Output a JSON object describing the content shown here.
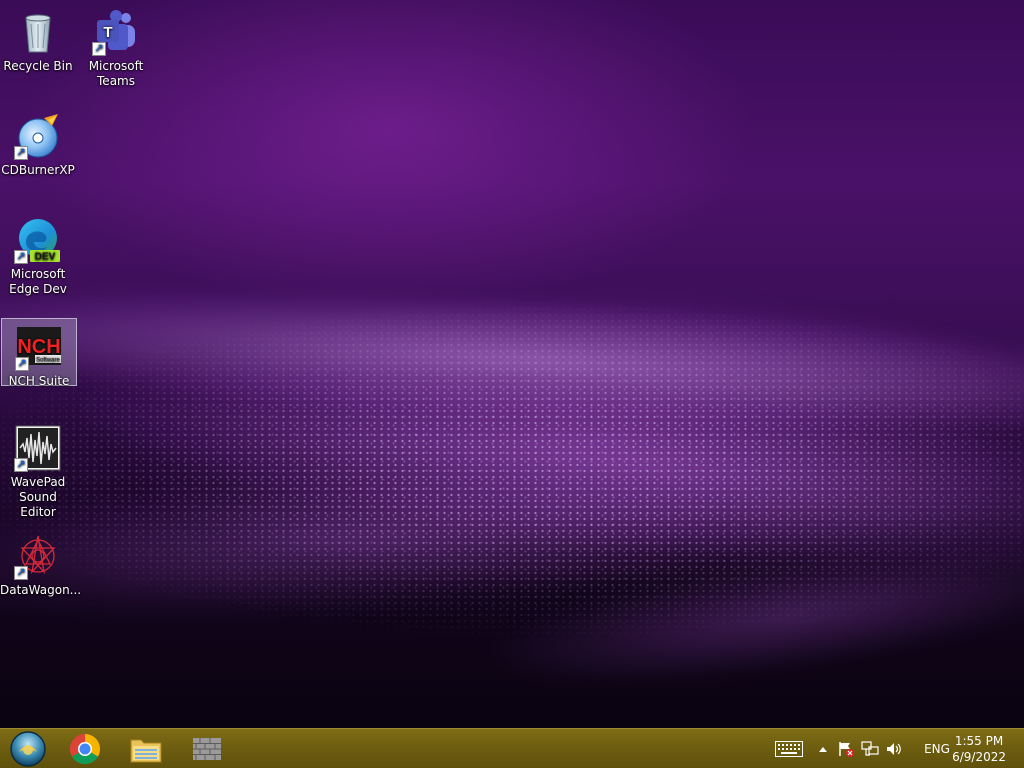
{
  "desktop": {
    "icons": [
      {
        "label": "Recycle Bin"
      },
      {
        "label": "Microsoft Teams"
      },
      {
        "label": "CDBurnerXP"
      },
      {
        "label": "Microsoft Edge Dev",
        "badge": "DEV"
      },
      {
        "label": "NCH Suite",
        "logo_text": "NCH",
        "logo_sub": "Software"
      },
      {
        "label": "WavePad Sound Editor"
      },
      {
        "label": "DataWagon..."
      }
    ]
  },
  "taskbar": {
    "pinned": [
      "start-orb",
      "chrome",
      "file-explorer",
      "wall-app"
    ],
    "tray": {
      "language": "ENG",
      "time": "1:55 PM",
      "date": "6/9/2022"
    }
  },
  "colors": {
    "taskbar": "#6d5d10",
    "wallpaper_dark": "#12051c",
    "wallpaper_purple": "#4a1168",
    "selection": "#bebed2"
  }
}
